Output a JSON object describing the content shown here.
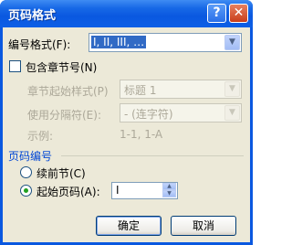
{
  "window": {
    "title": "页码格式",
    "help_glyph": "?",
    "close_glyph": "✕"
  },
  "number_format": {
    "label": "编号格式(F):",
    "value": "I, II, III, …"
  },
  "include_chapter": {
    "label": "包含章节号(N)",
    "checked": false
  },
  "chapter_style": {
    "label": "章节起始样式(P)",
    "value": "标题 1"
  },
  "separator": {
    "label": "使用分隔符(E):",
    "value": "-  (连字符)"
  },
  "example": {
    "label": "示例:",
    "value": "1-1, 1-A"
  },
  "page_numbering": {
    "group_label": "页码编号",
    "continue_label": "续前节(C)",
    "start_at_label": "起始页码(A):",
    "selected": "start_at",
    "start_at_value": "I"
  },
  "buttons": {
    "ok": "确定",
    "cancel": "取消"
  },
  "icons": {
    "dropdown": "▼",
    "spin_up": "▲",
    "spin_down": "▼"
  }
}
